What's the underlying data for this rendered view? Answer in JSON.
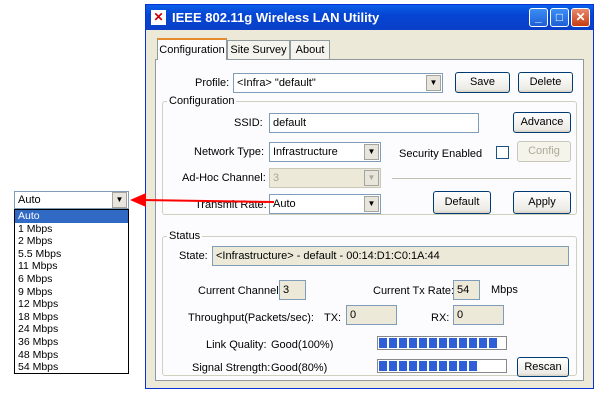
{
  "window": {
    "title": "IEEE 802.11g Wireless LAN Utility"
  },
  "tabs": [
    {
      "label": "Configuration"
    },
    {
      "label": "Site Survey"
    },
    {
      "label": "About"
    }
  ],
  "profile": {
    "label": "Profile:",
    "value": "<Infra> \"default\"",
    "save": "Save",
    "delete": "Delete"
  },
  "config_group": {
    "legend": "Configuration",
    "ssid_label": "SSID:",
    "ssid_value": "default",
    "advance": "Advance",
    "network_type_label": "Network Type:",
    "network_type_value": "Infrastructure",
    "security_label": "Security Enabled",
    "config_button": "Config",
    "adhoc_label": "Ad-Hoc Channel:",
    "adhoc_value": "3",
    "transmit_label": "Transmit Rate:",
    "transmit_value": "Auto",
    "default_button": "Default",
    "apply_button": "Apply"
  },
  "status_group": {
    "legend": "Status",
    "state_label": "State:",
    "state_value": "<Infrastructure> - default - 00:14:D1:C0:1A:44",
    "channel_label": "Current Channel:",
    "channel_value": "3",
    "txrate_label": "Current Tx Rate:",
    "txrate_value": "54",
    "txrate_unit": "Mbps",
    "throughput_label": "Throughput(Packets/sec):",
    "tx_label": "TX:",
    "tx_value": "0",
    "rx_label": "RX:",
    "rx_value": "0",
    "link_quality_label": "Link Quality:",
    "link_quality_value": "Good(100%)",
    "link_quality_level": 1.0,
    "signal_label": "Signal Strength:",
    "signal_value": "Good(80%)",
    "signal_level": 0.8,
    "rescan_button": "Rescan"
  },
  "rate_dropdown": {
    "selected": "Auto",
    "options": [
      "Auto",
      "1 Mbps",
      "2 Mbps",
      "5.5 Mbps",
      "11 Mbps",
      "6 Mbps",
      "9 Mbps",
      "12 Mbps",
      "18 Mbps",
      "24 Mbps",
      "36 Mbps",
      "48 Mbps",
      "54 Mbps"
    ]
  },
  "colors": {
    "arrow": "#ff0000",
    "titlebar": "#0a5fe8",
    "selection": "#316ac5"
  }
}
